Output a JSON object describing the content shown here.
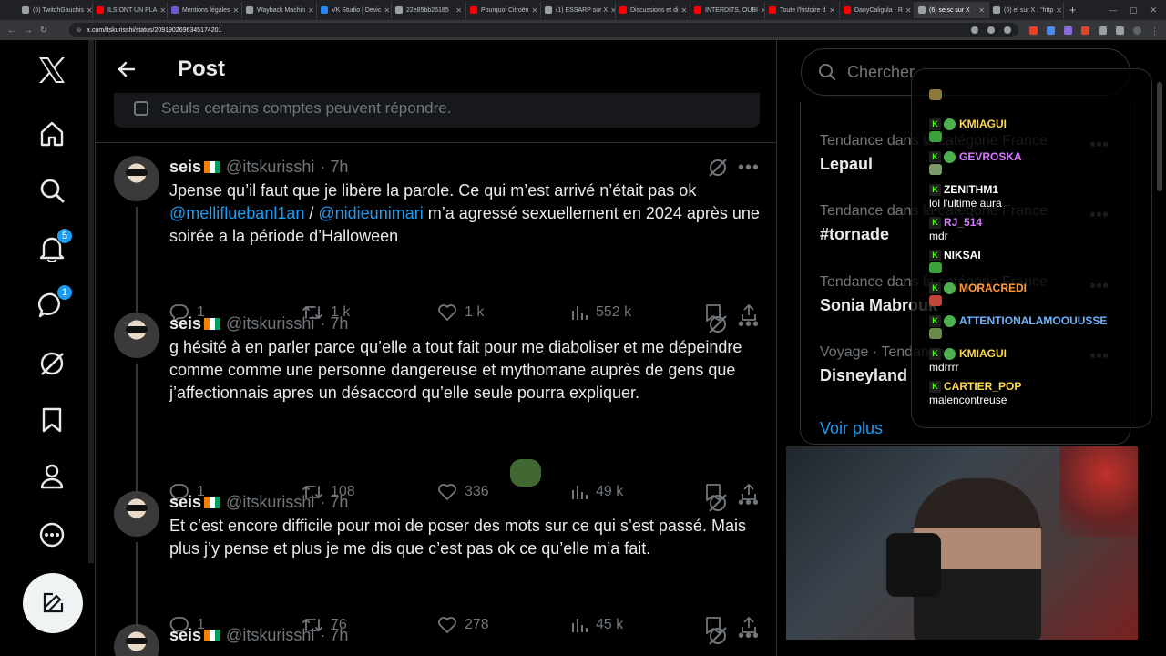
{
  "browser": {
    "tabs": [
      {
        "label": "(6) TwitchGauchis",
        "color": "#9aa0a6"
      },
      {
        "label": "ILS ONT UN PLA",
        "color": "#ff0000"
      },
      {
        "label": "Mentions légales",
        "color": "#6a5acd"
      },
      {
        "label": "Wayback Machin",
        "color": "#9aa0a6"
      },
      {
        "label": "VK Studio | Devic",
        "color": "#2787f5"
      },
      {
        "label": "22e85bb25185",
        "color": "#9aa0a6"
      },
      {
        "label": "Pourquoi Citroën",
        "color": "#ff0000"
      },
      {
        "label": "(1) ESSARP sur X",
        "color": "#9aa0a6"
      },
      {
        "label": "Discussions et di",
        "color": "#ff0000"
      },
      {
        "label": "INTERDITS, OUBI",
        "color": "#ff0000"
      },
      {
        "label": "Toute l'histoire d",
        "color": "#ff0000"
      },
      {
        "label": "DanyCaligula - R",
        "color": "#ff0000"
      },
      {
        "label": "(6) seisc sur X",
        "color": "#9aa0a6",
        "active": true
      },
      {
        "label": "(6) el sur X : \"http",
        "color": "#9aa0a6"
      }
    ],
    "url": "x.com/itskurisshi/status/2091902696345174201"
  },
  "nav": {
    "notif_badge": "5",
    "messages_badge": "1"
  },
  "header": {
    "title": "Post"
  },
  "reply_restriction": "Seuls certains comptes peuvent répondre.",
  "posts": [
    {
      "name": "seis",
      "handle": "@itskurisshi",
      "time": "· 7h",
      "text_parts": [
        "Jpense qu’il faut que je libère la parole. Ce qui m’est arrivé n’était pas ok"
      ],
      "mention1": "@mellifluebanl1an",
      "sep": " / ",
      "mention2": "@nidieunimari",
      "text_after": " m’a agressé sexuellement en 2024 après une soirée a la période d’Halloween",
      "replies": "1",
      "reposts": "1 k",
      "likes": "1 k",
      "views": "552 k"
    },
    {
      "name": "seis",
      "handle": "@itskurisshi",
      "time": "· 7h",
      "text": "g hésité à en parler parce qu’elle a tout fait pour me diaboliser et me dépeindre comme comme une personne dangereuse et mythomane auprès de gens que j’affectionnais apres un désaccord qu’elle seule pourra expliquer.",
      "replies": "1",
      "reposts": "108",
      "likes": "336",
      "views": "49 k"
    },
    {
      "name": "seis",
      "handle": "@itskurisshi",
      "time": "· 7h",
      "text": "Et c’est encore difficile pour moi de poser des mots sur ce qui s’est passé. Mais plus j’y pense et plus je me dis que c’est pas ok ce qu’elle m’a fait.",
      "replies": "1",
      "reposts": "76",
      "likes": "278",
      "views": "45 k"
    },
    {
      "name": "seis",
      "handle": "@itskurisshi",
      "time": "· 7h"
    }
  ],
  "search": {
    "placeholder": "Chercher"
  },
  "trends": [
    {
      "category": "Tendance dans la catégorie France",
      "name": "Lepaul"
    },
    {
      "category": "Tendance dans la catégorie France",
      "name": "#tornade"
    },
    {
      "category": "Tendance dans la catégorie France",
      "name": "Sonia Mabrouk"
    },
    {
      "category": "Voyage · Tendances",
      "name": "Disneyland"
    }
  ],
  "see_more": "Voir plus",
  "chat": [
    {
      "user": "KMIAGUI",
      "color": "#ffd84a",
      "text": ""
    },
    {
      "user": "GEVROSKA",
      "color": "#d77bff",
      "text": ""
    },
    {
      "user": "ZENITHM1",
      "color": "#ffffff",
      "text": "lol l'ultime aura"
    },
    {
      "user": "RJ_514",
      "color": "#d77bff",
      "text": "mdr"
    },
    {
      "user": "NIKSAI",
      "color": "#ffffff",
      "text": ""
    },
    {
      "user": "MORACREDI",
      "color": "#ff9a3c",
      "text": ""
    },
    {
      "user": "ATTENTIONALAMOOUUSSE",
      "color": "#6fb3ff",
      "text": ""
    },
    {
      "user": "KMIAGUI",
      "color": "#ffd84a",
      "text": "mdrrrr"
    },
    {
      "user": "CARTIER_POP",
      "color": "#ffd84a",
      "text": "malencontreuse"
    }
  ],
  "colors": {
    "accent": "#1d9bf0",
    "muted": "#71767b",
    "border": "#2f3336"
  }
}
